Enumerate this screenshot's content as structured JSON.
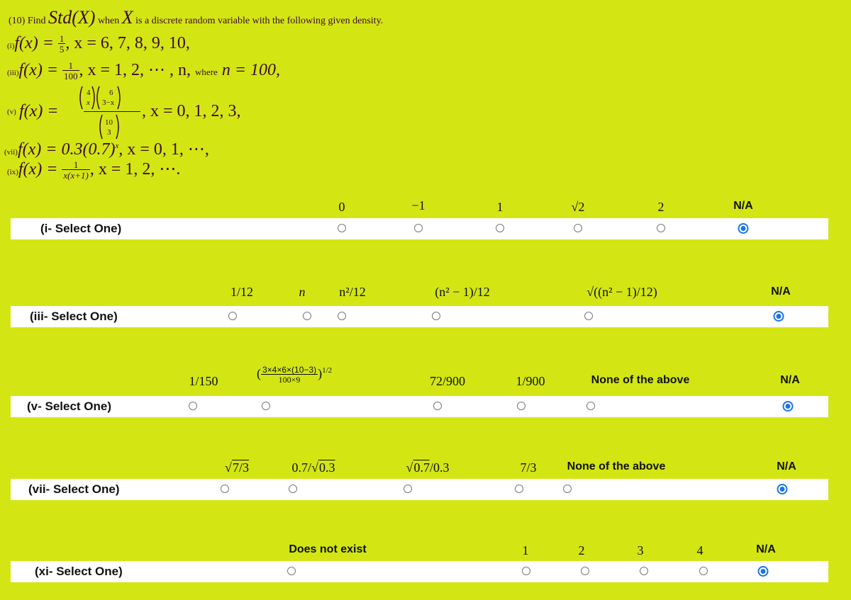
{
  "header": {
    "number": "(10)",
    "prefix": "Find",
    "func": "Std(X)",
    "when": "when",
    "var": "X",
    "rest": "is a discrete random variable with the following given density."
  },
  "densities": [
    {
      "tag": "(i)",
      "lhs": "f(x) =",
      "num": "1",
      "den": "5",
      "tail": ", x = 6, 7, 8, 9, 10,"
    },
    {
      "tag": "(iii)",
      "lhs": "f(x) =",
      "num": "1",
      "den": "100",
      "tail": ", x = 1, 2, ⋯ , n,",
      "where": "where",
      "cond": "n = 100,"
    },
    {
      "tag": "(v)",
      "lhs": "f(x) =",
      "num": "(4 choose x)(6 choose 3−x)",
      "den": "(10 choose 3)",
      "tail": ", x = 0, 1, 2, 3,"
    },
    {
      "tag": "(vii)",
      "lhs": "f(x) = 0.3(0.7)",
      "sup": "x",
      "tail": ", x = 0, 1, ⋯,"
    },
    {
      "tag": "(ix)",
      "lhs": "f(x) =",
      "num": "1",
      "den": "x(x+1)",
      "tail": ", x = 1, 2, ⋯."
    }
  ],
  "questions": [
    {
      "label": "(i- Select One)",
      "options": [
        "0",
        "−1",
        "1",
        "√2",
        "2",
        "N/A"
      ],
      "selected": 5
    },
    {
      "label": "(iii- Select One)",
      "options": [
        "1/12",
        "n",
        "n²/12",
        "(n² − 1)/12",
        "√((n² − 1)/12)",
        "N/A"
      ],
      "selected": 5
    },
    {
      "label": "(v- Select One)",
      "options": [
        "1/150",
        "(3×4×6×(10−3) / 100×9)^1/2",
        "72/900",
        "1/900",
        "None of the above",
        "N/A"
      ],
      "option_parts": {
        "frac_num": "3×4×6×(10−3)",
        "frac_den": "100×9",
        "exp": "1/2"
      },
      "selected": 5
    },
    {
      "label": "(vii- Select One)",
      "options": [
        "√7/3",
        "0.7/√0.3",
        "√0.7/0.3",
        "7/3",
        "None of the above",
        "N/A"
      ],
      "option_parts": {
        "o0": "7/3",
        "o1a": "0.7/",
        "o1b": "0.3",
        "o2a": "0.7",
        "o2b": "/0.3"
      },
      "selected": 5
    },
    {
      "label": "(xi- Select One)",
      "options": [
        "Does not exist",
        "1",
        "2",
        "3",
        "4",
        "N/A"
      ],
      "selected": 5
    }
  ],
  "colors": {
    "background": "#d3e614",
    "selected": "#1a73e8"
  }
}
